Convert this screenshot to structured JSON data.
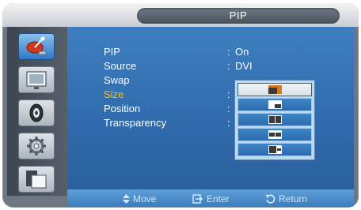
{
  "window": {
    "title": "PIP"
  },
  "sidebar": {
    "items": [
      {
        "icon": "satellite-dish-icon",
        "active": true
      },
      {
        "icon": "display-screen-icon",
        "active": false
      },
      {
        "icon": "speaker-icon",
        "active": false
      },
      {
        "icon": "gear-icon",
        "active": false
      },
      {
        "icon": "multi-window-icon",
        "active": false
      }
    ]
  },
  "menu": {
    "items": [
      {
        "label": "PIP",
        "value": "On"
      },
      {
        "label": "Source",
        "value": "DVI"
      },
      {
        "label": "Swap",
        "value": ""
      },
      {
        "label": "Size",
        "value": ""
      },
      {
        "label": "Position",
        "value": ""
      },
      {
        "label": "Transparency",
        "value": ""
      }
    ],
    "selected_label": "Size",
    "colon": ":"
  },
  "size_dropdown": {
    "options": [
      {
        "icon": "pip-small-corner-icon",
        "selected": true
      },
      {
        "icon": "pip-inset-icon",
        "selected": false
      },
      {
        "icon": "pip-side-by-side-icon",
        "selected": false
      },
      {
        "icon": "pip-side-by-side-wide-icon",
        "selected": false
      },
      {
        "icon": "pip-split-right-icon",
        "selected": false
      }
    ]
  },
  "navbar": {
    "move": "Move",
    "enter": "Enter",
    "return": "Return"
  },
  "colors": {
    "panel_blue": "#2f6aab",
    "selected_text": "#f5c400",
    "title_bar": "#e8eaec"
  }
}
